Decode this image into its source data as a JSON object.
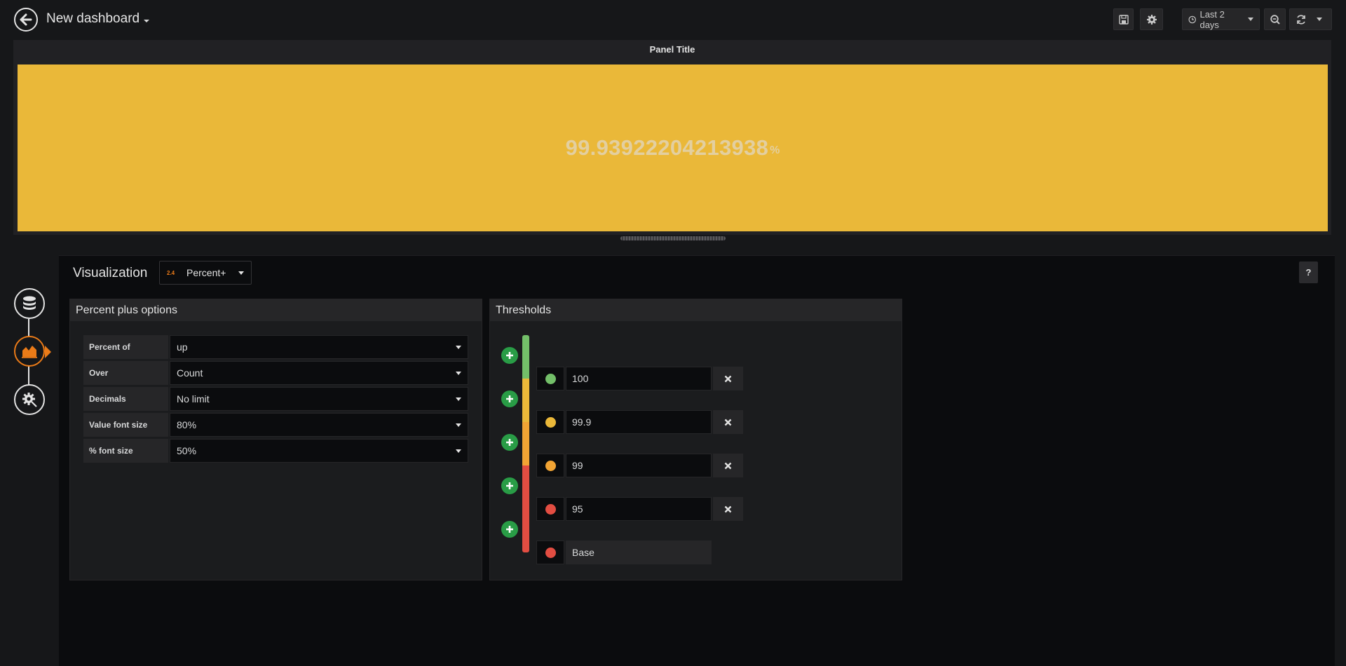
{
  "navbar": {
    "title": "New dashboard",
    "time_range": "Last 2 days"
  },
  "panel": {
    "title": "Panel Title",
    "value": "99.93922204213938",
    "unit": "%",
    "background_color": "#eab839"
  },
  "editor": {
    "visualization_label": "Visualization",
    "visualization_type": "Percent+",
    "visualization_thumb": "2.4",
    "help_label": "?",
    "options_group": {
      "title": "Percent plus options",
      "rows": [
        {
          "label": "Percent of",
          "value": "up"
        },
        {
          "label": "Over",
          "value": "Count"
        },
        {
          "label": "Decimals",
          "value": "No limit"
        },
        {
          "label": "Value font size",
          "value": "80%"
        },
        {
          "label": "% font size",
          "value": "50%"
        }
      ]
    },
    "thresholds_group": {
      "title": "Thresholds",
      "steps": [
        {
          "value": "100",
          "color": "#73bf69"
        },
        {
          "value": "99.9",
          "color": "#eab839"
        },
        {
          "value": "99",
          "color": "#f2a434"
        },
        {
          "value": "95",
          "color": "#e24d42"
        },
        {
          "value": "Base",
          "color": "#e24d42"
        }
      ]
    }
  },
  "sidebar": {
    "items": [
      {
        "icon": "database-icon"
      },
      {
        "icon": "visualization-icon",
        "active": true
      },
      {
        "icon": "general-settings-icon"
      }
    ]
  }
}
